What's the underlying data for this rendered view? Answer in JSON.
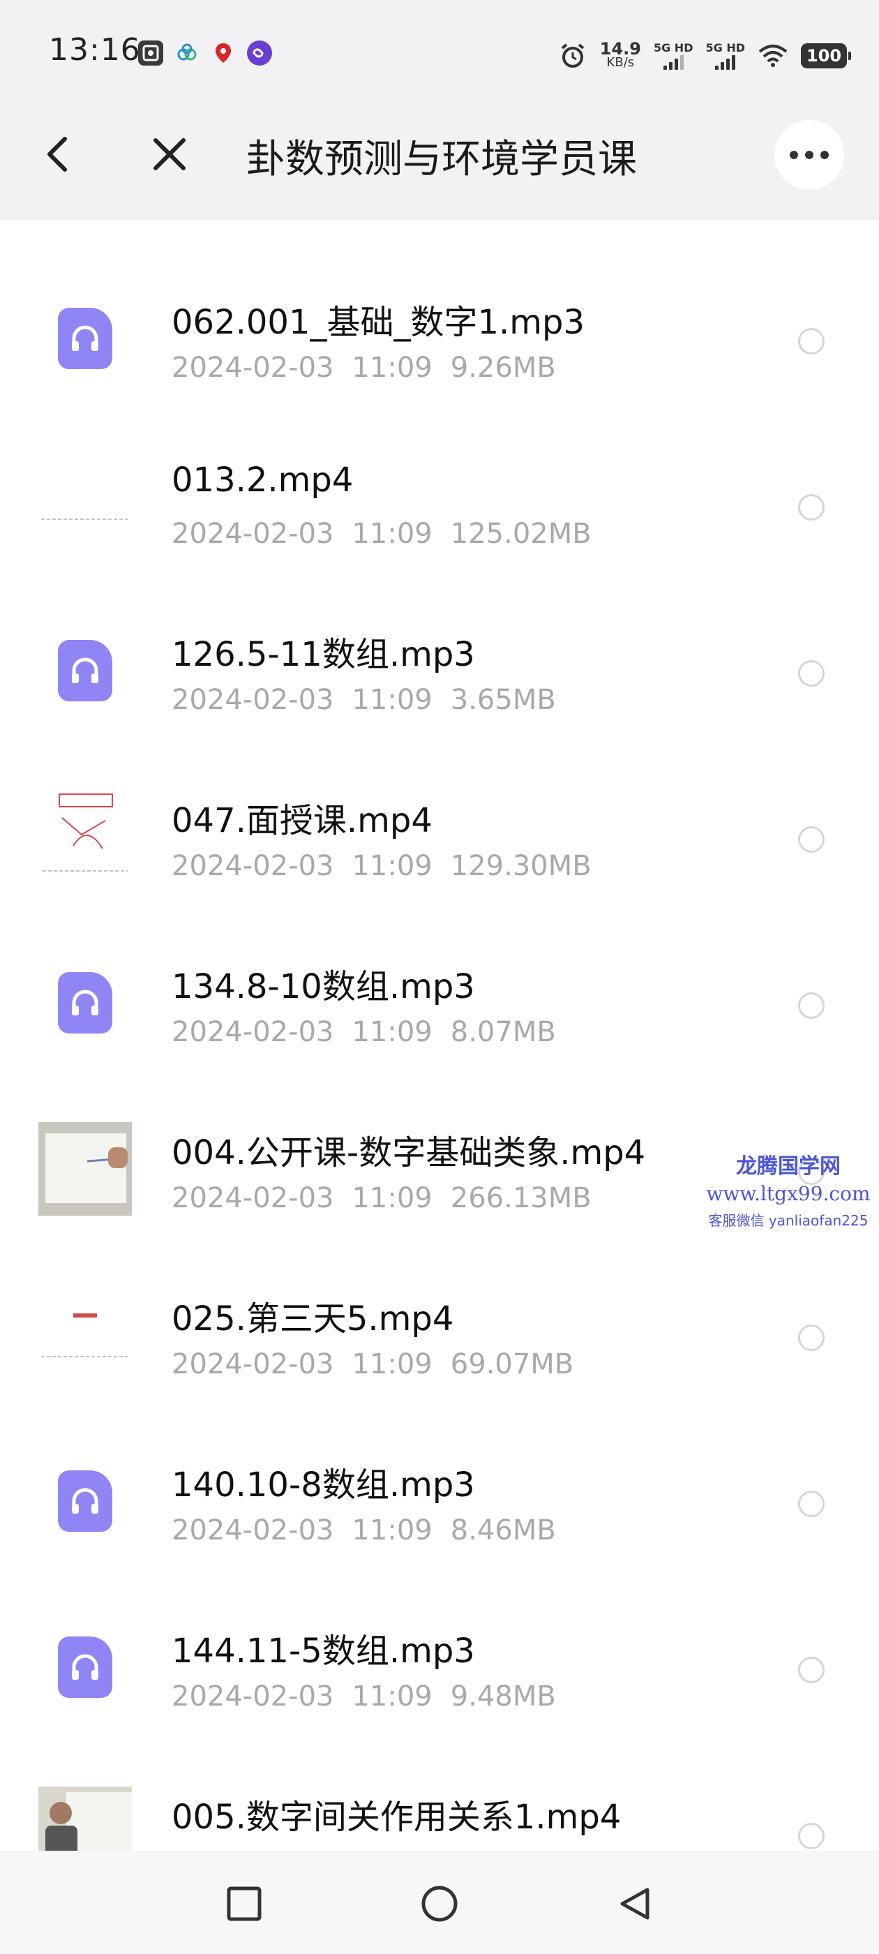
{
  "status_bar": {
    "time": "13:16",
    "speed_value": "14.9",
    "speed_unit": "KB/s",
    "sim1_label": "5G HD",
    "sim2_label": "5G HD",
    "battery": "100",
    "icons": [
      "image-icon",
      "cloud-icon",
      "location-pin-icon",
      "link-icon",
      "alarm-icon",
      "signal-icon",
      "wifi-icon",
      "battery-icon"
    ]
  },
  "header": {
    "title": "卦数预测与环境学员课",
    "back_icon": "chevron-left-icon",
    "close_icon": "close-icon",
    "more_icon": "more-icon"
  },
  "files": [
    {
      "name": "062.001_基础_数字1.mp3",
      "date": "2024-02-03",
      "time": "11:09",
      "size": "9.26MB",
      "kind": "audio"
    },
    {
      "name": "013.2.mp4",
      "date": "2024-02-03",
      "time": "11:09",
      "size": "125.02MB",
      "kind": "video"
    },
    {
      "name": "126.5-11数组.mp3",
      "date": "2024-02-03",
      "time": "11:09",
      "size": "3.65MB",
      "kind": "audio"
    },
    {
      "name": "047.面授课.mp4",
      "date": "2024-02-03",
      "time": "11:09",
      "size": "129.30MB",
      "kind": "video"
    },
    {
      "name": "134.8-10数组.mp3",
      "date": "2024-02-03",
      "time": "11:09",
      "size": "8.07MB",
      "kind": "audio"
    },
    {
      "name": "004.公开课-数字基础类象.mp4",
      "date": "2024-02-03",
      "time": "11:09",
      "size": "266.13MB",
      "kind": "video"
    },
    {
      "name": "025.第三天5.mp4",
      "date": "2024-02-03",
      "time": "11:09",
      "size": "69.07MB",
      "kind": "video"
    },
    {
      "name": "140.10-8数组.mp3",
      "date": "2024-02-03",
      "time": "11:09",
      "size": "8.46MB",
      "kind": "audio"
    },
    {
      "name": "144.11-5数组.mp3",
      "date": "2024-02-03",
      "time": "11:09",
      "size": "9.48MB",
      "kind": "audio"
    },
    {
      "name": "005.数字间关作用关系1.mp4",
      "date": "",
      "time": "",
      "size": "",
      "kind": "video"
    }
  ],
  "watermark": {
    "line1": "龙腾国学网",
    "line2": "www.ltgx99.com",
    "line3": "客服微信 yanliaofan225"
  },
  "nav_bar": {
    "icons": [
      "recents-square-icon",
      "home-circle-icon",
      "back-triangle-icon"
    ]
  },
  "colors": {
    "accent": "#8f85f5",
    "meta_text": "#a9a9a9",
    "bar_background": "#f2f2f4",
    "watermark": "#4a55d8"
  }
}
